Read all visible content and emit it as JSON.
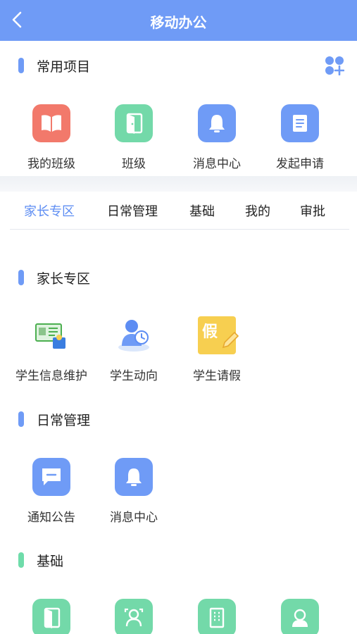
{
  "header": {
    "title": "移动办公"
  },
  "common": {
    "title": "常用项目",
    "items": [
      {
        "label": "我的班级",
        "icon": "book-icon",
        "color": "#f2796b"
      },
      {
        "label": "班级",
        "icon": "door-icon",
        "color": "#73d9a9"
      },
      {
        "label": "消息中心",
        "icon": "bell-icon",
        "color": "#6f9bf6"
      },
      {
        "label": "发起申请",
        "icon": "document-icon",
        "color": "#6f9bf6"
      }
    ]
  },
  "tabs": [
    {
      "label": "家长专区",
      "active": true
    },
    {
      "label": "日常管理"
    },
    {
      "label": "基础"
    },
    {
      "label": "我的"
    },
    {
      "label": "审批"
    }
  ],
  "parent_zone": {
    "title": "家长专区",
    "items": [
      {
        "label": "学生信息维护",
        "icon": "student-card-icon"
      },
      {
        "label": "学生动向",
        "icon": "student-clock-icon"
      },
      {
        "label": "学生请假",
        "icon": "leave-note-icon",
        "glyph": "假"
      }
    ]
  },
  "daily": {
    "title": "日常管理",
    "items": [
      {
        "label": "通知公告",
        "icon": "message-icon"
      },
      {
        "label": "消息中心",
        "icon": "bell-icon"
      }
    ]
  },
  "basic": {
    "title": "基础",
    "items": [
      {
        "icon": "door-icon"
      },
      {
        "icon": "users-icon"
      },
      {
        "icon": "building-icon"
      },
      {
        "icon": "person-icon"
      }
    ]
  },
  "colors": {
    "primary": "#6f9bf6",
    "green": "#73d9a9",
    "red": "#f2796b",
    "yellow": "#f7cf50"
  }
}
